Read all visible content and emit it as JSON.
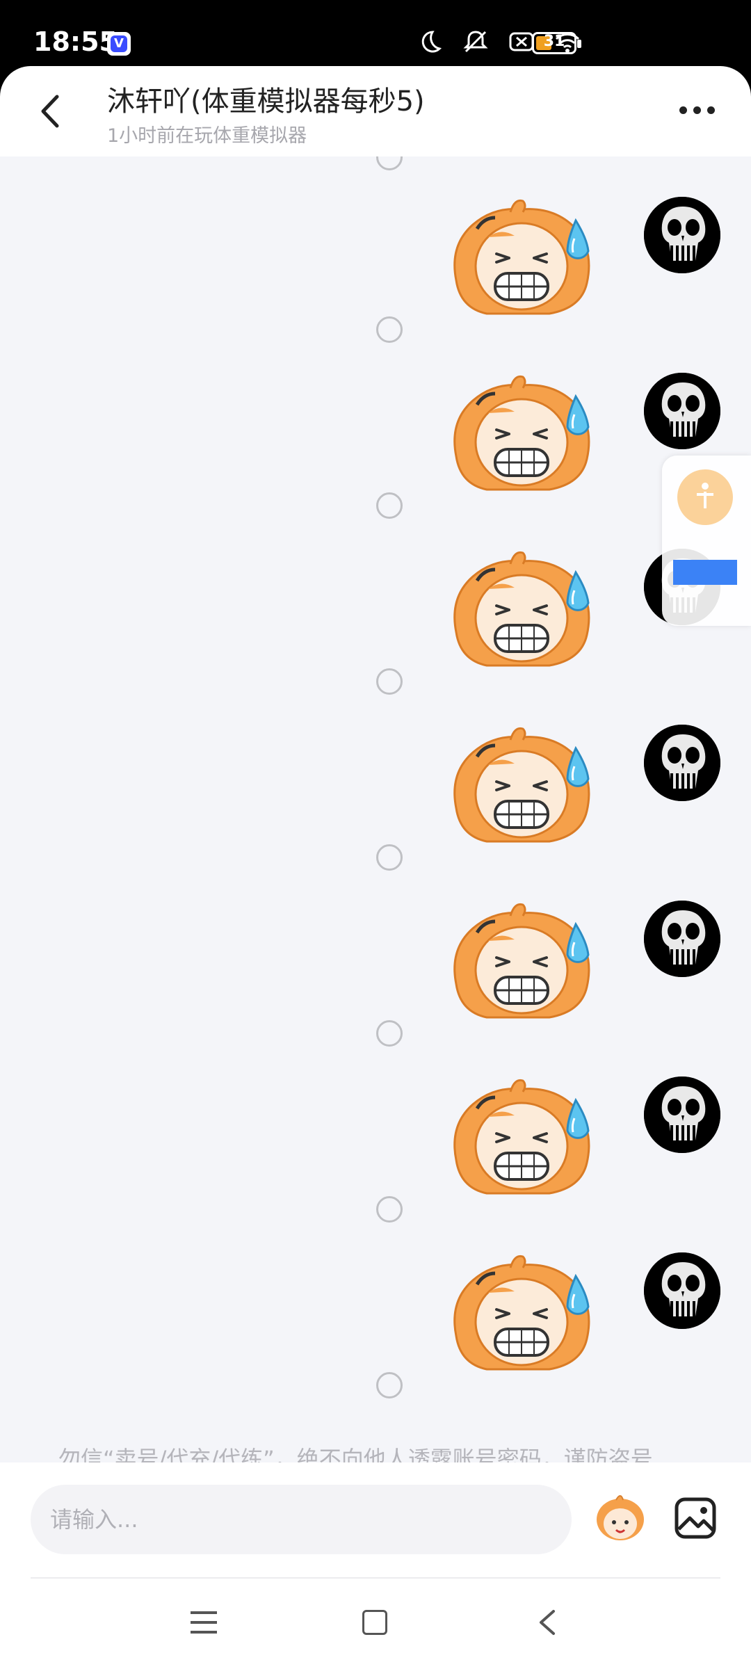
{
  "status_bar": {
    "time": "18:55",
    "app_badge": "V",
    "battery_level": "31",
    "icons": [
      "moon-icon",
      "notifications-off-icon",
      "mobile-data-off-icon",
      "wifi-icon",
      "battery-icon"
    ]
  },
  "header": {
    "title": "沐轩吖(体重模拟器每秒5)",
    "subtitle": "1小时前在玩体重模拟器"
  },
  "messages": [
    {
      "sender": "self",
      "type": "sticker",
      "sticker": "sweat-grin-face"
    },
    {
      "sender": "self",
      "type": "sticker",
      "sticker": "sweat-grin-face"
    },
    {
      "sender": "self",
      "type": "sticker",
      "sticker": "sweat-grin-face"
    },
    {
      "sender": "self",
      "type": "sticker",
      "sticker": "sweat-grin-face"
    },
    {
      "sender": "self",
      "type": "sticker",
      "sticker": "sweat-grin-face"
    },
    {
      "sender": "self",
      "type": "sticker",
      "sticker": "sweat-grin-face"
    },
    {
      "sender": "self",
      "type": "sticker",
      "sticker": "sweat-grin-face"
    }
  ],
  "notice": "勿信“卖号/代充/代练”，绝不向他人透露账号密码，谨防盗号",
  "input": {
    "placeholder": "请输入..."
  },
  "colors": {
    "background": "#f4f5f9",
    "sticker_orange": "#f5a04a",
    "sweat_blue": "#5cc4f0",
    "accent_blue": "#3b82f6"
  }
}
